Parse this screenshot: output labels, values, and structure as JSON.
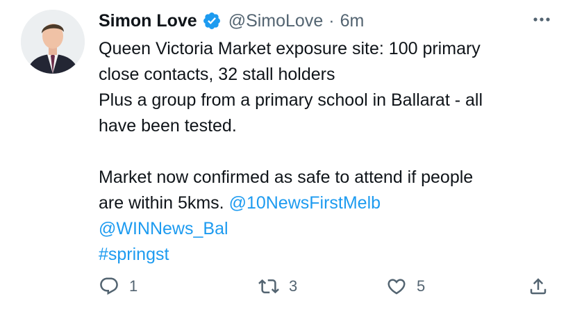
{
  "author": {
    "display_name": "Simon Love",
    "handle": "@SimoLove",
    "separator": "·",
    "time": "6m",
    "verified": true
  },
  "tweet": {
    "lines": [
      "Queen Victoria Market exposure site: 100 primary",
      "close contacts, 32 stall holders",
      "Plus a group from a primary school in Ballarat - all",
      "have been tested.",
      "Market now confirmed as safe to attend if people",
      "are within 5kms. "
    ],
    "mentions": [
      "@10NewsFirstMelb",
      "@WINNews_Bal"
    ],
    "hashtag": "#springst"
  },
  "actions": {
    "reply_count": "1",
    "retweet_count": "3",
    "like_count": "5"
  },
  "icons": {
    "verified": "verified-badge-icon",
    "more": "more-icon",
    "reply": "reply-icon",
    "retweet": "retweet-icon",
    "like": "heart-icon",
    "share": "share-icon"
  },
  "colors": {
    "text": "#0f1419",
    "secondary": "#536471",
    "link": "#1d9bf0",
    "verified": "#1d9bf0"
  }
}
